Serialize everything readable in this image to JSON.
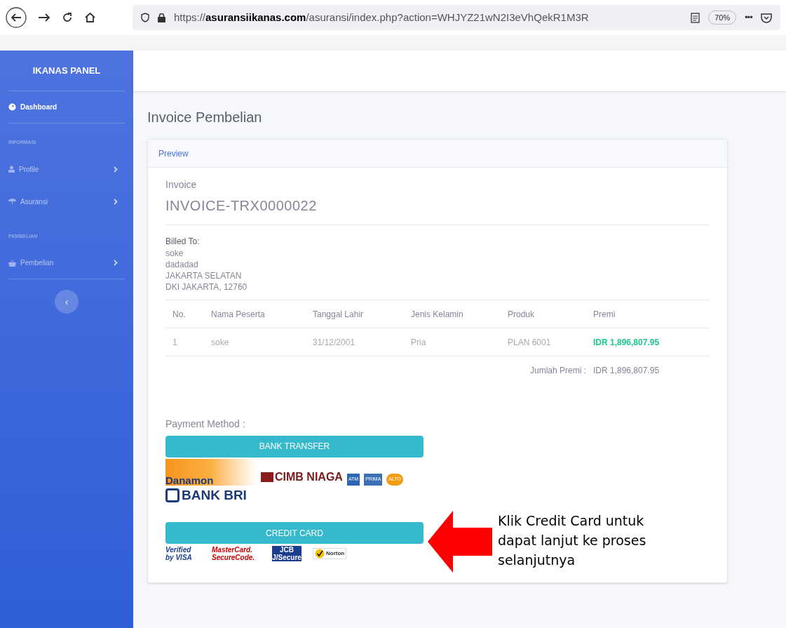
{
  "browser": {
    "url_prefix": "https://",
    "url_domain": "asuransiikanas.com",
    "url_path": "/asuransi/index.php?action=WHJYZ21wN2I3eVhQekR1M3R",
    "zoom": "70%",
    "more": "•••"
  },
  "sidebar": {
    "brand": "IKANAS PANEL",
    "items": [
      {
        "kind": "link",
        "label": "Dashboard",
        "selected": true
      },
      {
        "kind": "heading",
        "label": "INFORMASI"
      },
      {
        "kind": "link",
        "label": "Profile",
        "selected": false
      },
      {
        "kind": "link",
        "label": "Asuransi",
        "selected": false
      },
      {
        "kind": "heading",
        "label": "PEMBELIAN"
      },
      {
        "kind": "link",
        "label": "Pembelian",
        "selected": false
      }
    ],
    "toggle": "‹"
  },
  "page": {
    "title": "Invoice Pembelian",
    "card_header": "Preview",
    "invoice_label": "Invoice",
    "invoice_number": "INVOICE-TRX0000022",
    "billed_to": {
      "label": "Billed To:",
      "lines": [
        "soke",
        "dadadad",
        "JAKARTA SELATAN",
        "DKI JAKARTA, 12760"
      ]
    },
    "table": {
      "columns": [
        "No.",
        "Nama Peserta",
        "Tanggal Lahir",
        "Jenis Kelamin",
        "Produk",
        "Premi"
      ],
      "rows": [
        [
          "1",
          "soke",
          "31/12/2001",
          "Pria",
          "PLAN 6001",
          "IDR 1,896,807.95"
        ]
      ],
      "total_label": "Jumlah Premi :",
      "total_value": "IDR 1,896,807.95"
    },
    "payment_label": "Payment Method :",
    "bank_transfer": "BANK TRANSFER",
    "bank_logos": [
      "Danamon",
      "CIMB NIAGA",
      "ATM",
      "PRIMA",
      "ALTO",
      "BANK BRI"
    ],
    "credit_card": "CREDIT CARD",
    "card_logos": [
      "Verified by VISA",
      "MasterCard. SecureCode.",
      "JCB J/Secure",
      "Norton"
    ]
  },
  "annotation": {
    "text": "Klik Credit Card untuk dapat lanjut ke proses selanjutnya"
  }
}
